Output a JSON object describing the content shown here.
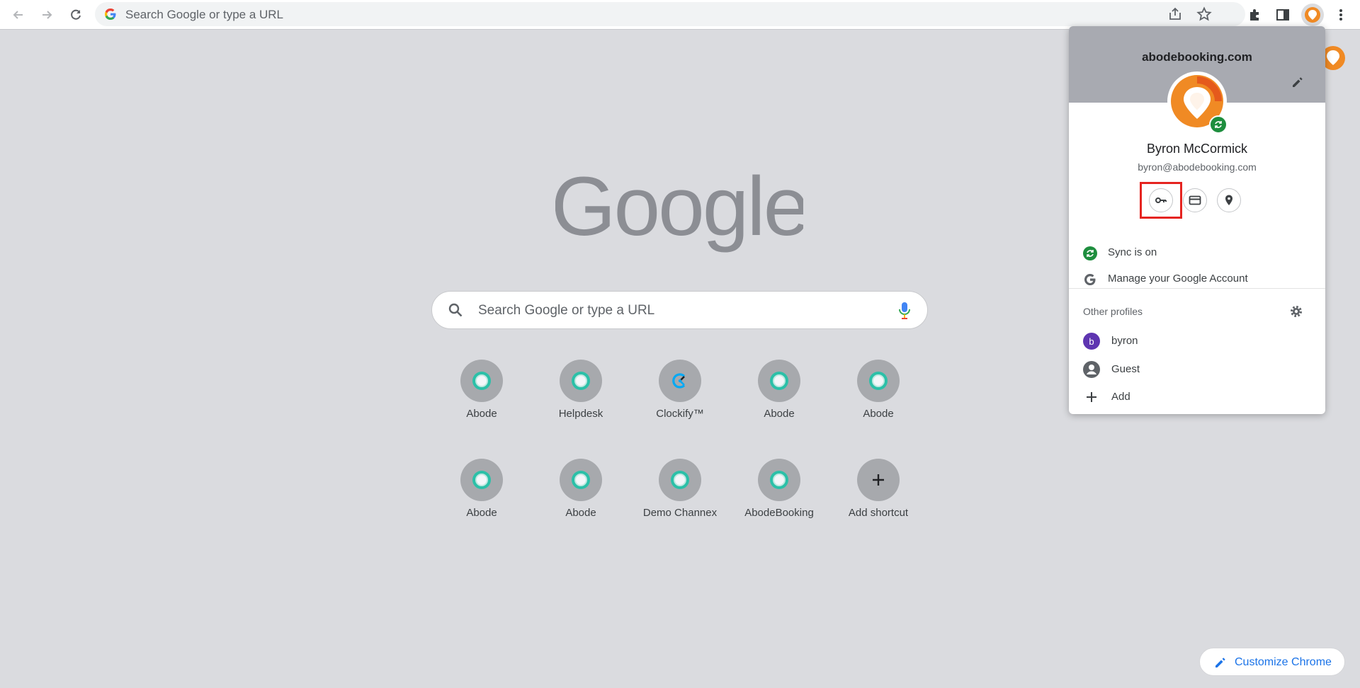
{
  "browser": {
    "omnibox_placeholder": "Search Google or type a URL"
  },
  "ntp": {
    "logo_text": "Google",
    "search_placeholder": "Search Google or type a URL",
    "shortcuts": [
      {
        "label": "Abode",
        "icon": "abode-favicon"
      },
      {
        "label": "Helpdesk",
        "icon": "abode-favicon"
      },
      {
        "label": "Clockify™",
        "icon": "clockify-favicon"
      },
      {
        "label": "Abode",
        "icon": "abode-favicon"
      },
      {
        "label": "Abode",
        "icon": "abode-favicon"
      },
      {
        "label": "Abode",
        "icon": "abode-favicon"
      },
      {
        "label": "Abode",
        "icon": "abode-favicon"
      },
      {
        "label": "Demo Channex",
        "icon": "abode-favicon"
      },
      {
        "label": "AbodeBooking",
        "icon": "abode-favicon"
      },
      {
        "label": "Add shortcut",
        "icon": "plus-icon"
      }
    ],
    "customize_label": "Customize Chrome"
  },
  "profile_menu": {
    "organization": "abodebooking.com",
    "name": "Byron McCormick",
    "email": "byron@abodebooking.com",
    "quick_actions": [
      "key-icon",
      "credit-card-icon",
      "location-pin-icon"
    ],
    "sync_label": "Sync is on",
    "manage_label": "Manage your Google Account",
    "other_profiles_label": "Other profiles",
    "profiles": [
      {
        "name": "byron",
        "initial": "b",
        "color": "#5e35b1"
      },
      {
        "name": "Guest",
        "icon": "guest-person-icon"
      }
    ],
    "add_label": "Add"
  },
  "colors": {
    "accent": "#1a73e8",
    "sync_green": "#1e8e3e",
    "highlight_red": "#e52420",
    "page_background": "#dadbdf"
  }
}
